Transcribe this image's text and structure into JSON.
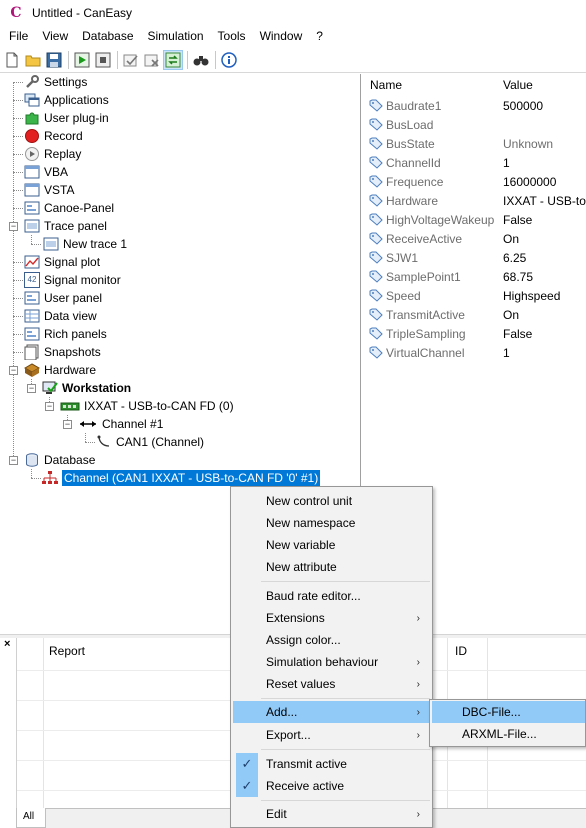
{
  "window": {
    "title": "Untitled - CanEasy",
    "app_icon_glyph": "C"
  },
  "menubar": [
    "File",
    "View",
    "Database",
    "Simulation",
    "Tools",
    "Window",
    "?"
  ],
  "toolbar": {
    "icons": [
      "new-file-icon",
      "open-folder-icon",
      "save-icon",
      "start-simulation-icon",
      "stop-simulation-icon",
      "check-icon",
      "cancel-check-icon",
      "sync-icon",
      "binoculars-icon",
      "info-icon"
    ]
  },
  "tree": {
    "items": [
      {
        "label": "Settings",
        "icon": "wrench-icon"
      },
      {
        "label": "Applications",
        "icon": "applications-icon"
      },
      {
        "label": "User plug-in",
        "icon": "puzzle-icon"
      },
      {
        "label": "Record",
        "icon": "record-icon"
      },
      {
        "label": "Replay",
        "icon": "replay-icon"
      },
      {
        "label": "VBA",
        "icon": "window-icon"
      },
      {
        "label": "VSTA",
        "icon": "window-icon"
      },
      {
        "label": "Canoe-Panel",
        "icon": "panel-icon"
      },
      {
        "label": "Trace panel",
        "icon": "trace-icon"
      },
      {
        "label": "New trace 1",
        "icon": "trace-icon"
      },
      {
        "label": "Signal plot",
        "icon": "plot-icon"
      },
      {
        "label": "Signal monitor",
        "icon": "monitor-icon"
      },
      {
        "label": "User panel",
        "icon": "panel-icon"
      },
      {
        "label": "Data view",
        "icon": "table-icon"
      },
      {
        "label": "Rich panels",
        "icon": "panel-icon"
      },
      {
        "label": "Snapshots",
        "icon": "snapshot-icon"
      },
      {
        "label": "Hardware",
        "icon": "hardware-icon"
      },
      {
        "label": "Workstation",
        "icon": "workstation-icon"
      },
      {
        "label": "IXXAT - USB-to-CAN FD (0)",
        "icon": "usb-device-icon"
      },
      {
        "label": "Channel #1",
        "icon": "bidirectional-arrow-icon"
      },
      {
        "label": "CAN1 (Channel)",
        "icon": "cable-icon"
      },
      {
        "label": "Database",
        "icon": "database-icon"
      },
      {
        "label": "Channel (CAN1 IXXAT - USB-to-CAN FD '0' #1)",
        "icon": "network-icon"
      }
    ],
    "monitor_badge": "42"
  },
  "properties": {
    "header": {
      "name": "Name",
      "value": "Value"
    },
    "rows": [
      {
        "name": "Baudrate1",
        "value": "500000"
      },
      {
        "name": "BusLoad",
        "value": ""
      },
      {
        "name": "BusState",
        "value": "Unknown"
      },
      {
        "name": "ChannelId",
        "value": "1"
      },
      {
        "name": "Frequence",
        "value": "16000000"
      },
      {
        "name": "Hardware",
        "value": "IXXAT - USB-to-"
      },
      {
        "name": "HighVoltageWakeup",
        "value": "False"
      },
      {
        "name": "ReceiveActive",
        "value": "On"
      },
      {
        "name": "SJW1",
        "value": "6.25"
      },
      {
        "name": "SamplePoint1",
        "value": "68.75"
      },
      {
        "name": "Speed",
        "value": "Highspeed"
      },
      {
        "name": "TransmitActive",
        "value": "On"
      },
      {
        "name": "TripleSampling",
        "value": "False"
      },
      {
        "name": "VirtualChannel",
        "value": "1"
      }
    ]
  },
  "report": {
    "close_glyph": "×",
    "columns": {
      "report": "Report",
      "id": "ID"
    },
    "tab": "All"
  },
  "context_menu": {
    "items": [
      {
        "label": "New control unit"
      },
      {
        "label": "New namespace"
      },
      {
        "label": "New variable"
      },
      {
        "label": "New attribute"
      },
      {
        "label": "Baud rate editor..."
      },
      {
        "label": "Extensions"
      },
      {
        "label": "Assign color..."
      },
      {
        "label": "Simulation behaviour"
      },
      {
        "label": "Reset values"
      },
      {
        "label": "Add..."
      },
      {
        "label": "Export..."
      },
      {
        "label": "Transmit active"
      },
      {
        "label": "Receive active"
      },
      {
        "label": "Edit"
      }
    ],
    "check_glyph": "✓",
    "arrow_glyph": "›"
  },
  "submenu": {
    "items": [
      {
        "label": "DBC-File..."
      },
      {
        "label": "ARXML-File..."
      }
    ]
  },
  "colors": {
    "selection": "#0078d7",
    "menu_highlight": "#91c9f7",
    "property_name_gray": "#6d6d6d"
  }
}
